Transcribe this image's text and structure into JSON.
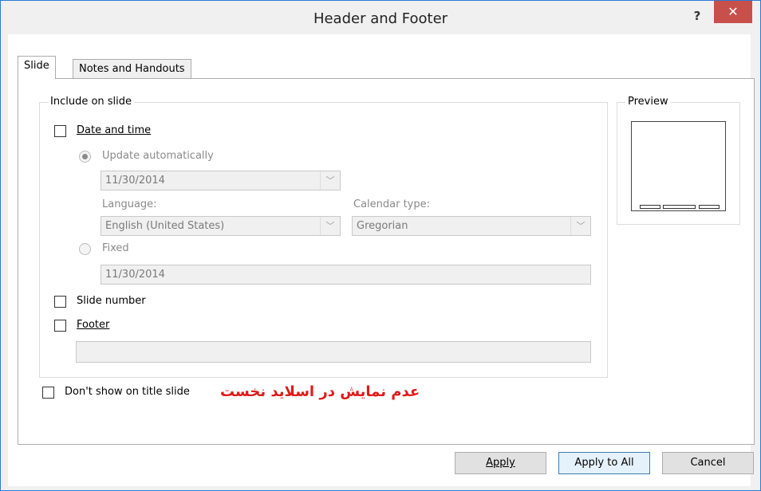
{
  "window": {
    "title": "Header and Footer",
    "help_glyph": "?",
    "close_glyph": "✕"
  },
  "tabs": [
    {
      "label": "Slide",
      "active": true
    },
    {
      "label": "Notes and Handouts",
      "active": false
    }
  ],
  "include_group": {
    "legend": "Include on slide",
    "date_time": {
      "label": "Date and time",
      "checked": false
    },
    "update_auto": {
      "label": "Update automatically",
      "selected": true,
      "value": "11/30/2014"
    },
    "language": {
      "label": "Language:",
      "value": "English (United States)"
    },
    "calendar": {
      "label": "Calendar type:",
      "value": "Gregorian"
    },
    "fixed": {
      "label": "Fixed",
      "selected": false,
      "value": "11/30/2014"
    },
    "slide_number": {
      "label": "Slide number",
      "checked": false
    },
    "footer": {
      "label": "Footer",
      "checked": false,
      "value": ""
    }
  },
  "preview": {
    "legend": "Preview"
  },
  "dont_show": {
    "label": "Don't show on title slide",
    "checked": false
  },
  "annotation": "عدم نمایش در اسلاید نخست",
  "buttons": {
    "apply": "Apply",
    "apply_all": "Apply to All",
    "cancel": "Cancel"
  },
  "colors": {
    "close_red": "#c7504b",
    "annotation_red": "#e01a1a",
    "window_border": "#2b79d8"
  }
}
